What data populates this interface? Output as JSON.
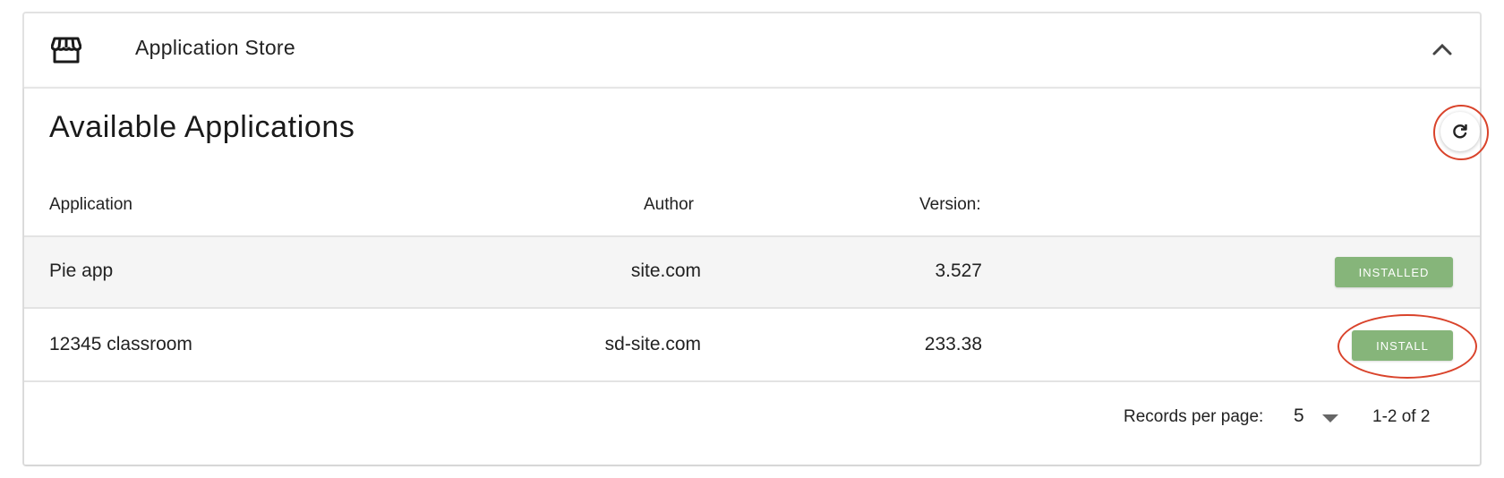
{
  "panel": {
    "title": "Application Store",
    "icon": "store-icon",
    "collapse_icon": "chevron-up-icon"
  },
  "card": {
    "title": "Available Applications",
    "refresh_icon": "refresh-icon"
  },
  "table": {
    "columns": [
      "Application",
      "Author",
      "Version:"
    ],
    "rows": [
      {
        "application": "Pie app",
        "author": "site.com",
        "version": "3.527",
        "action": "INSTALLED"
      },
      {
        "application": "12345 classroom",
        "author": "sd-site.com",
        "version": "233.38",
        "action": "INSTALL"
      }
    ]
  },
  "pagination": {
    "records_label": "Records per page:",
    "records_value": "5",
    "range": "1-2 of 2"
  },
  "colors": {
    "button_green": "#86b57a",
    "highlight_red": "#d9432b"
  }
}
